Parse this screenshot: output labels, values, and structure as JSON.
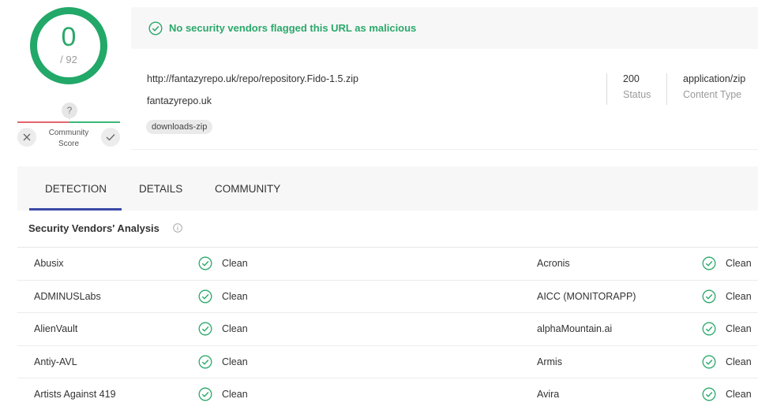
{
  "score": {
    "detections": "0",
    "total": "/ 92"
  },
  "community": {
    "badge": "?",
    "label_line1": "Community",
    "label_line2": "Score"
  },
  "verdict": {
    "text": "No security vendors flagged this URL as malicious"
  },
  "info": {
    "url": "http://fantazyrepo.uk/repo/repository.Fido-1.5.zip",
    "domain": "fantazyrepo.uk",
    "tag": "downloads-zip",
    "status_value": "200",
    "status_label": "Status",
    "content_type_value": "application/zip",
    "content_type_label": "Content Type"
  },
  "tabs": {
    "detection": "DETECTION",
    "details": "DETAILS",
    "community": "COMMUNITY"
  },
  "section": {
    "title": "Security Vendors' Analysis"
  },
  "vendors": [
    {
      "left_name": "Abusix",
      "left_result": "Clean",
      "right_name": "Acronis",
      "right_result": "Clean"
    },
    {
      "left_name": "ADMINUSLabs",
      "left_result": "Clean",
      "right_name": "AICC (MONITORAPP)",
      "right_result": "Clean"
    },
    {
      "left_name": "AlienVault",
      "left_result": "Clean",
      "right_name": "alphaMountain.ai",
      "right_result": "Clean"
    },
    {
      "left_name": "Antiy-AVL",
      "left_result": "Clean",
      "right_name": "Armis",
      "right_result": "Clean"
    },
    {
      "left_name": "Artists Against 419",
      "left_result": "Clean",
      "right_name": "Avira",
      "right_result": "Clean"
    }
  ],
  "colors": {
    "accent_green": "#2aa86a",
    "ring_green": "#22a868",
    "tab_underline": "#3b4aa8",
    "community_red": "#e5646e"
  },
  "icons": {
    "verdict": "check-circle-icon",
    "vote_down": "close-icon",
    "vote_up": "check-icon",
    "result": "check-circle-icon",
    "section_info": "info-icon"
  }
}
